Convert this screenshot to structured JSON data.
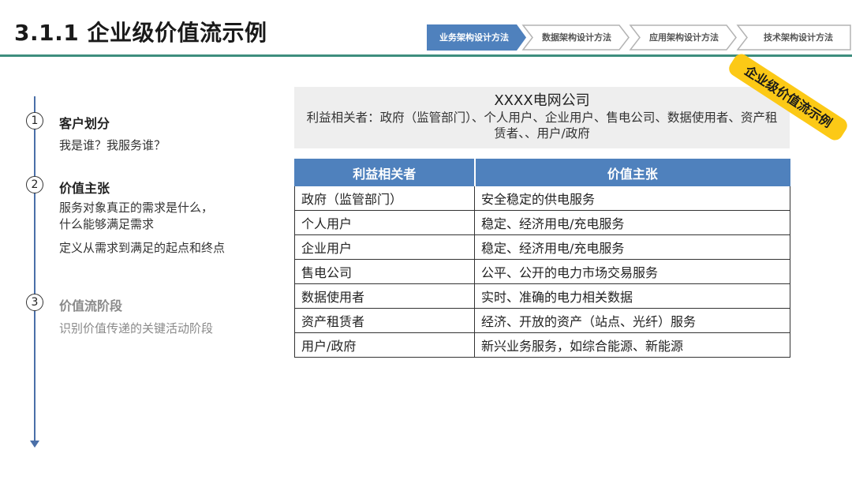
{
  "header": {
    "title": "3.1.1 企业级价值流示例",
    "process_steps": [
      {
        "label": "业务架构设计方法",
        "active": true
      },
      {
        "label": "数据架构设计方法",
        "active": false
      },
      {
        "label": "应用架构设计方法",
        "active": false
      },
      {
        "label": "技术架构设计方法",
        "active": false
      }
    ]
  },
  "colors": {
    "accent_teal": "#3e8e7e",
    "active_step": "#4f81bd",
    "inactive_step": "#b3b3b3",
    "table_header": "#4f81bd",
    "badge": "#fcc916",
    "timeline": "#4a6fa8"
  },
  "steps": [
    {
      "num": "1",
      "title": "客户划分",
      "desc": [
        "我是谁？我服务谁？"
      ]
    },
    {
      "num": "2",
      "title": "价值主张",
      "desc": [
        "服务对象真正的需求是什么，",
        "什么能够满足需求",
        "定义从需求到满足的起点和终点"
      ]
    },
    {
      "num": "3",
      "title": "价值流阶段",
      "desc": [
        "识别价值传递的关键活动阶段"
      ],
      "dimmed": true
    }
  ],
  "company": {
    "name": "XXXX电网公司",
    "stakeholders_text": "利益相关者：政府（监管部门）、个人用户、企业用户、售电公司、数据使用者、资产租赁者、、用户/政府"
  },
  "badge": {
    "label": "企业级价值流示例"
  },
  "table": {
    "headers": [
      "利益相关者",
      "价值主张"
    ],
    "rows": [
      [
        "政府（监管部门）",
        "安全稳定的供电服务"
      ],
      [
        "个人用户",
        "稳定、经济用电/充电服务"
      ],
      [
        "企业用户",
        "稳定、经济用电/充电服务"
      ],
      [
        "售电公司",
        "公平、公开的电力市场交易服务"
      ],
      [
        "数据使用者",
        "实时、准确的电力相关数据"
      ],
      [
        "资产租赁者",
        "经济、开放的资产（站点、光纤）服务"
      ],
      [
        "用户/政府",
        "新兴业务服务，如综合能源、新能源"
      ]
    ]
  }
}
